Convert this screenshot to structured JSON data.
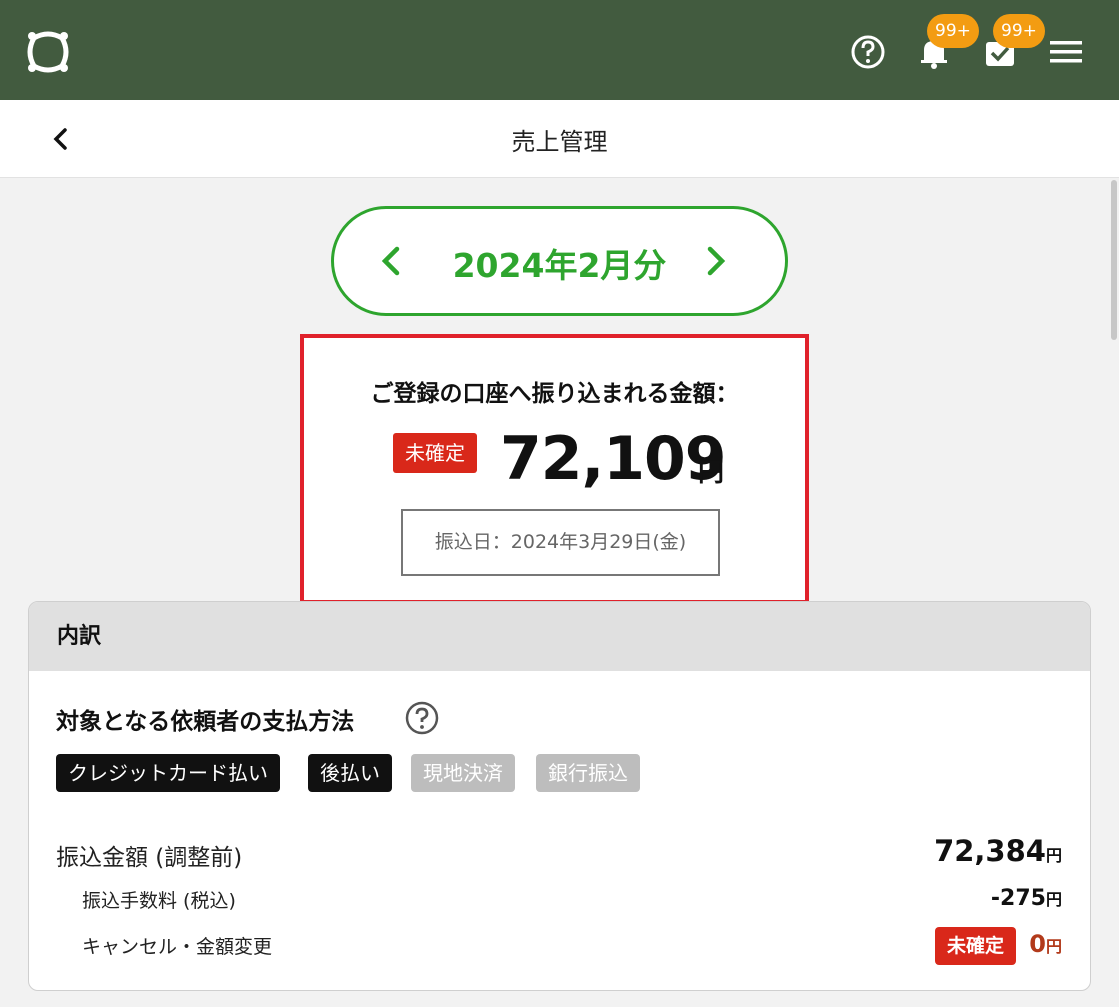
{
  "appbar": {
    "notifications_badge": "99+",
    "tasks_badge": "99+",
    "icons": [
      "logo-icon",
      "help-icon",
      "bell-icon",
      "tasks-icon",
      "menu-icon"
    ],
    "color": "#425b3f",
    "badge_color": "#f39c12"
  },
  "page": {
    "title": "売上管理"
  },
  "month_selector": {
    "label": "2024年2月分",
    "color": "#2ea52e"
  },
  "payout": {
    "caption": "ご登録の口座へ振り込まれる金額：",
    "status": "未確定",
    "amount": "72,109",
    "unit": "円",
    "transfer_date": "振込日：2024年3月29日(金)",
    "highlight_color": "#e0212b"
  },
  "breakdown": {
    "heading": "内訳",
    "method_title": "対象となる依頼者の支払方法",
    "payment_methods": [
      {
        "label": "クレジットカード払い",
        "active": true
      },
      {
        "label": "後払い",
        "active": true
      },
      {
        "label": "現地決済",
        "active": false
      },
      {
        "label": "銀行振込",
        "active": false
      }
    ],
    "rows": {
      "gross_label": "振込金額 (調整前)",
      "gross_value": "72,384",
      "fee_label": "振込手数料 (税込)",
      "fee_value": "-275",
      "cancel_label": "キャンセル・金額変更",
      "cancel_status": "未確定",
      "cancel_value": "0",
      "unit": "円"
    }
  }
}
